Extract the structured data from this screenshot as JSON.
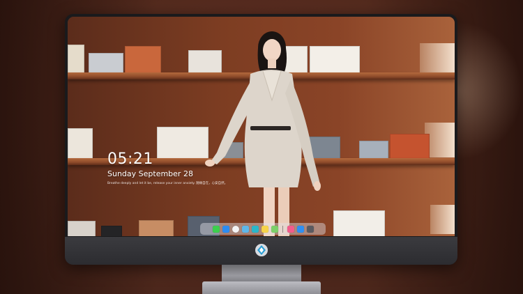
{
  "lock_screen": {
    "time": "05:21",
    "date": "Sunday September  28",
    "quote": "Breathe deeply and let it be, release your inner anxiety. 随缘自在，心安自然。"
  },
  "dock": {
    "apps": [
      {
        "name": "messages-icon",
        "color": "#3ccf4e"
      },
      {
        "name": "finder-icon",
        "color": "#2d8cf0"
      },
      {
        "name": "clock-icon",
        "color": "#f4f4f4"
      },
      {
        "name": "preview-icon",
        "color": "#5fb7e8"
      },
      {
        "name": "clapper-icon",
        "color": "#2bb6c9"
      },
      {
        "name": "notes-icon",
        "color": "#f6d34a"
      },
      {
        "name": "photos-icon",
        "color": "#7ccf6a"
      },
      {
        "name": "music-icon",
        "color": "#f25c8b"
      },
      {
        "name": "app-store-icon",
        "color": "#2f8ff2"
      },
      {
        "name": "camera-icon",
        "color": "#5a5a60"
      }
    ]
  },
  "colors": {
    "wall": "#7d3d22",
    "shelf": "#b46a3d",
    "bezel": "#1a1a1c",
    "chin": "#333337"
  }
}
